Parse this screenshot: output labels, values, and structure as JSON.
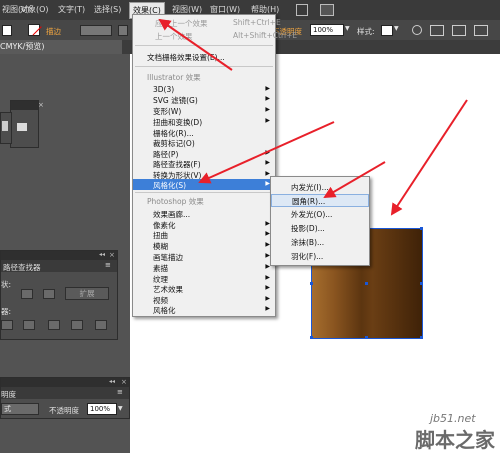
{
  "menubar": {
    "items": [
      {
        "label": "视图(V)"
      },
      {
        "label": "对象(O)"
      },
      {
        "label": "文字(T)"
      },
      {
        "label": "选择(S)"
      },
      {
        "label": "效果(C)"
      },
      {
        "label": "视图(W)"
      },
      {
        "label": "窗口(W)"
      },
      {
        "label": "帮助(H)"
      }
    ]
  },
  "controlbar": {
    "stroke_label": "描边",
    "opacity_label": "不透明度",
    "opacity_value": "100%",
    "style_label": "样式:"
  },
  "document": {
    "tab_label": "CMYK/预览)"
  },
  "effect_menu": {
    "items": [
      {
        "label": "应用上一个效果",
        "shortcut": "Shift+Ctrl+E",
        "state": "disabled"
      },
      {
        "label": "上一个效果",
        "shortcut": "Alt+Shift+Ctrl+E",
        "state": "disabled"
      },
      {
        "label": "文档栅格效果设置(E)...",
        "state": "normal"
      },
      {
        "label": "Illustrator 效果",
        "state": "header"
      },
      {
        "label": "3D(3)",
        "submenu": true
      },
      {
        "label": "SVG 滤镜(G)",
        "submenu": true
      },
      {
        "label": "变形(W)",
        "submenu": true
      },
      {
        "label": "扭曲和变换(D)",
        "submenu": true
      },
      {
        "label": "栅格化(R)...",
        "state": "normal"
      },
      {
        "label": "裁剪标记(O)",
        "state": "normal"
      },
      {
        "label": "路径(P)",
        "submenu": true
      },
      {
        "label": "路径查找器(F)",
        "submenu": true
      },
      {
        "label": "转换为形状(V)",
        "submenu": true
      },
      {
        "label": "风格化(S)",
        "submenu": true,
        "state": "highlighted"
      },
      {
        "label": "Photoshop 效果",
        "state": "header"
      },
      {
        "label": "效果画廊...",
        "state": "normal"
      },
      {
        "label": "像素化",
        "submenu": true
      },
      {
        "label": "扭曲",
        "submenu": true
      },
      {
        "label": "模糊",
        "submenu": true
      },
      {
        "label": "画笔描边",
        "submenu": true
      },
      {
        "label": "素描",
        "submenu": true
      },
      {
        "label": "纹理",
        "submenu": true
      },
      {
        "label": "艺术效果",
        "submenu": true
      },
      {
        "label": "视频",
        "submenu": true
      },
      {
        "label": "风格化",
        "submenu": true
      }
    ]
  },
  "stylize_submenu": {
    "items": [
      {
        "label": "内发光(I)..."
      },
      {
        "label": "圆角(R)...",
        "state": "hovered"
      },
      {
        "label": "外发光(O)..."
      },
      {
        "label": "投影(D)..."
      },
      {
        "label": "涂抹(B)..."
      },
      {
        "label": "羽化(F)..."
      }
    ]
  },
  "pathfinder_panel": {
    "title": "路径查找器",
    "expand_label": "扩展",
    "shape_label": "状:",
    "finder_label": "器:"
  },
  "transparency_panel": {
    "title": "明度",
    "mode_value": "式",
    "opacity_label": "不透明度",
    "opacity_value": "100%"
  },
  "watermark": {
    "site": "jb51.net",
    "name": "脚本之家"
  },
  "colors": {
    "menu_highlight": "#3d7fd8",
    "arrow": "#e8202a",
    "selection": "#1a57d6",
    "menubar": "#3a3a3a"
  }
}
